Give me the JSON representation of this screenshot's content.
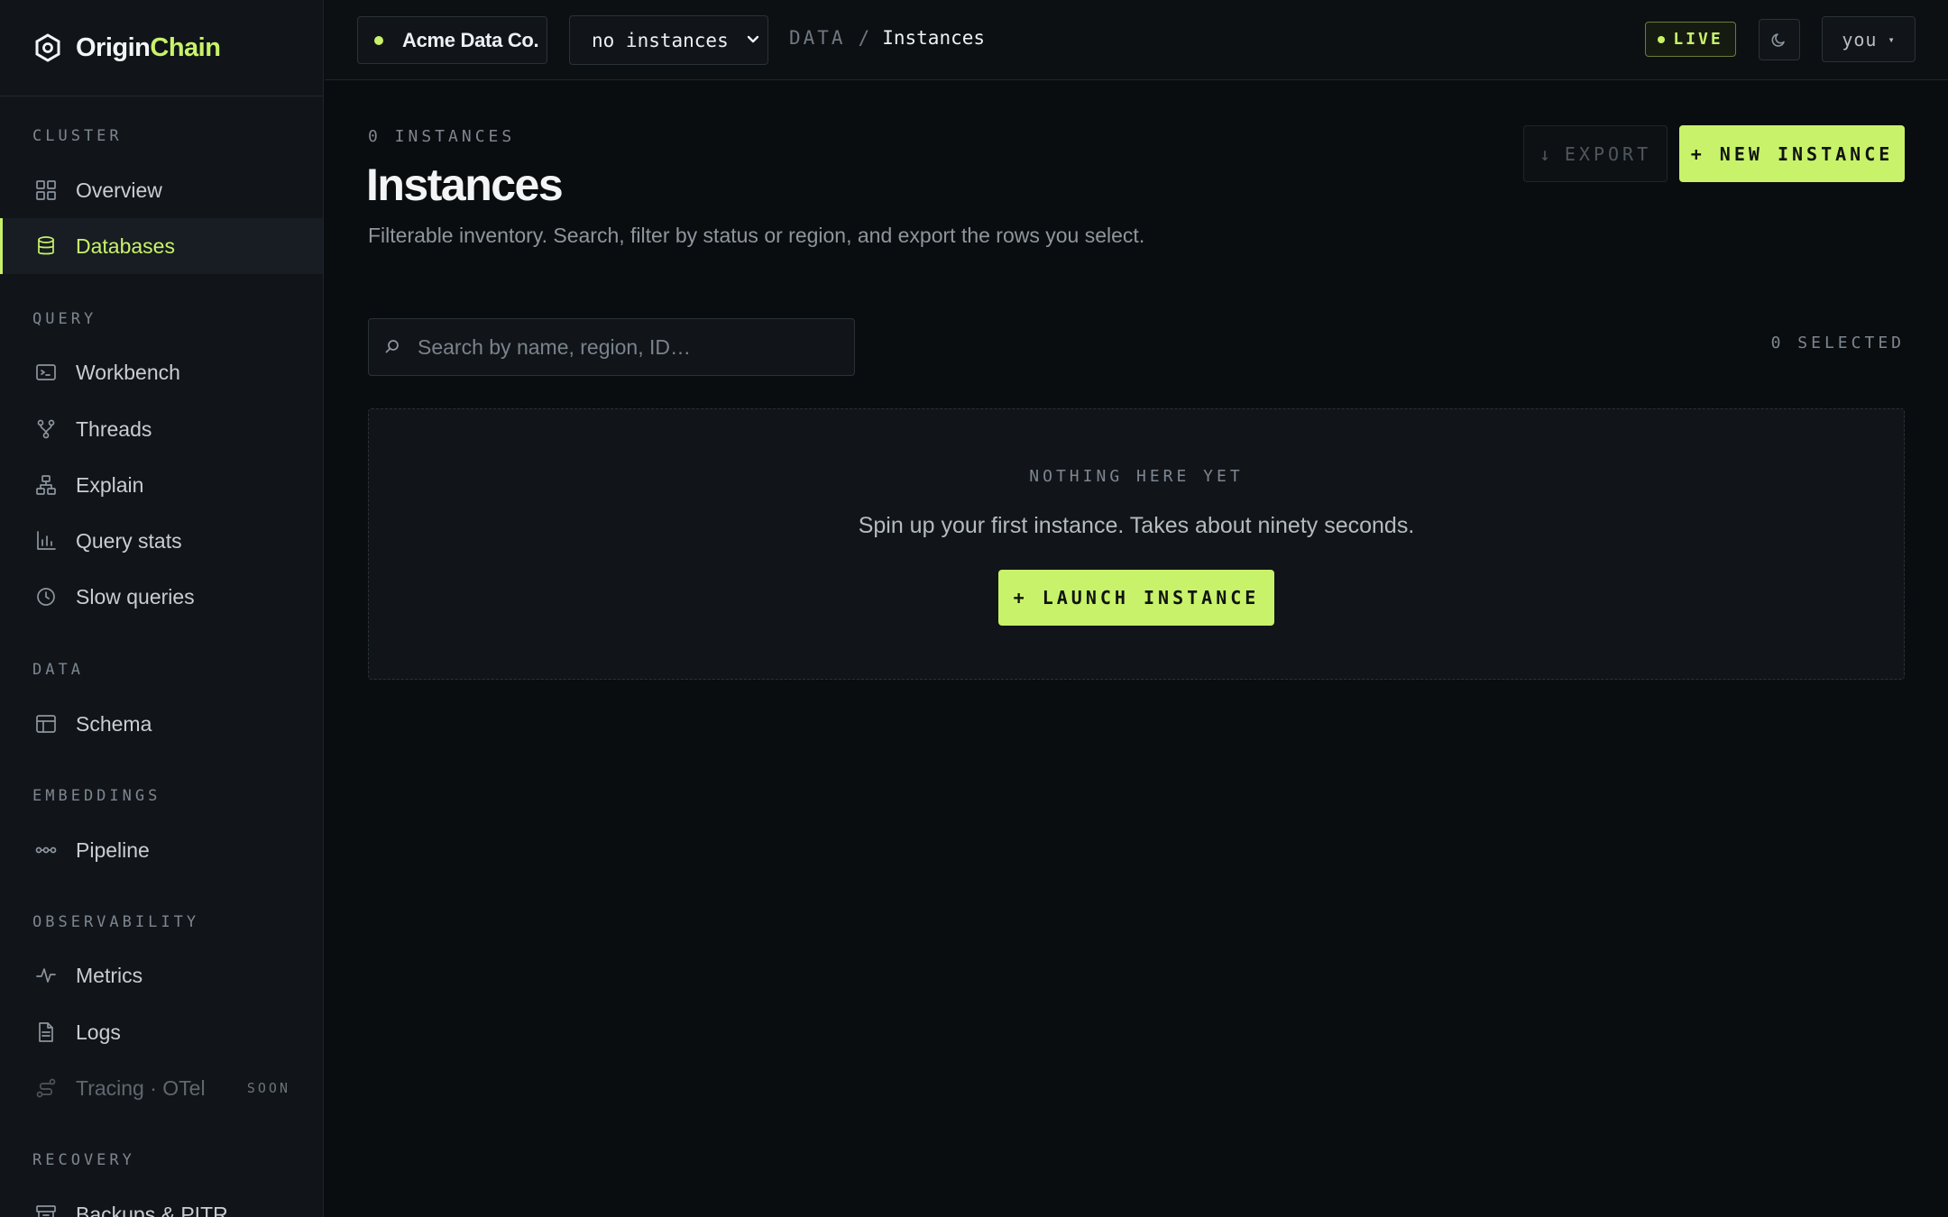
{
  "brand": {
    "name_a": "Origin",
    "name_b": "Chain",
    "icon": "hexagon-logo-icon"
  },
  "sidebar": {
    "sections": [
      {
        "label": "CLUSTER"
      },
      {
        "label": "QUERY"
      },
      {
        "label": "DATA"
      },
      {
        "label": "EMBEDDINGS"
      },
      {
        "label": "OBSERVABILITY"
      },
      {
        "label": "RECOVERY"
      }
    ],
    "items": [
      {
        "label": "Overview",
        "icon": "grid-icon"
      },
      {
        "label": "Databases",
        "icon": "database-icon",
        "active": true
      },
      {
        "label": "Workbench",
        "icon": "terminal-icon"
      },
      {
        "label": "Threads",
        "icon": "fork-icon"
      },
      {
        "label": "Explain",
        "icon": "hierarchy-icon"
      },
      {
        "label": "Query stats",
        "icon": "bar-chart-icon"
      },
      {
        "label": "Slow queries",
        "icon": "clock-icon"
      },
      {
        "label": "Schema",
        "icon": "table-icon"
      },
      {
        "label": "Pipeline",
        "icon": "pipeline-icon"
      },
      {
        "label": "Metrics",
        "icon": "pulse-icon"
      },
      {
        "label": "Logs",
        "icon": "file-icon"
      },
      {
        "label": "Tracing · OTel",
        "icon": "route-icon",
        "badge": "SOON",
        "disabled": true
      },
      {
        "label": "Backups & PITR",
        "icon": "archive-icon"
      }
    ]
  },
  "topbar": {
    "org": "Acme Data Co.",
    "instance_select": "no instances",
    "breadcrumb": {
      "section": "DATA",
      "separator": "/",
      "page": "Instances"
    },
    "live_label": "LIVE",
    "user_label": "you",
    "user_caret": "▾"
  },
  "main": {
    "count_label": "0 INSTANCES",
    "title": "Instances",
    "subtitle": "Filterable inventory. Search, filter by status or region, and export the rows you select.",
    "export_label": "EXPORT",
    "new_instance_label": "+ NEW INSTANCE",
    "search_placeholder": "Search by name, region, ID…",
    "selected_label": "0 SELECTED",
    "empty": {
      "kicker": "NOTHING HERE YET",
      "message": "Spin up your first instance. Takes about ninety seconds.",
      "button": "+ LAUNCH INSTANCE"
    }
  },
  "colors": {
    "accent": "#c8f26a",
    "background": "#0a0d0f",
    "sidebar": "#111519",
    "muted": "#7d8690"
  }
}
